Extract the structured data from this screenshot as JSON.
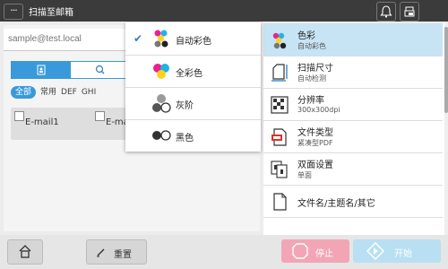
{
  "titlebar": {
    "menu_label": "···",
    "title": "扫描至邮箱",
    "icons": [
      "bell-icon",
      "trash-device-icon"
    ]
  },
  "left": {
    "email_placeholder": "sample@test.local",
    "filters": [
      "全部",
      "常用",
      "DEF",
      "GHI"
    ],
    "selected_filter": "全部",
    "entries": [
      "E-mail1",
      "E-ma"
    ]
  },
  "dropdown": {
    "selected": "自动彩色",
    "items": [
      {
        "label": "自动彩色",
        "icon": "auto-color-icon"
      },
      {
        "label": "全彩色",
        "icon": "full-color-icon"
      },
      {
        "label": "灰阶",
        "icon": "grayscale-icon"
      },
      {
        "label": "黑色",
        "icon": "black-icon"
      }
    ]
  },
  "settings": [
    {
      "label": "色彩",
      "value": "自动彩色",
      "icon": "color-icon",
      "active": true
    },
    {
      "label": "扫描尺寸",
      "value": "自动检测",
      "icon": "scan-size-icon"
    },
    {
      "label": "分辨率",
      "value": "300x300dpi",
      "icon": "resolution-icon"
    },
    {
      "label": "文件类型",
      "value": "紧凑型PDF",
      "icon": "pdf-icon"
    },
    {
      "label": "双面设置",
      "value": "单面",
      "icon": "duplex-icon"
    },
    {
      "label": "文件名/主题名/其它",
      "value": "",
      "icon": "file-icon"
    }
  ],
  "bottom": {
    "home_icon": "home-icon",
    "reset_label": "重置",
    "stop_label": "停止",
    "start_label": "开始"
  },
  "colors": {
    "accent": "#3a9ad9",
    "selected_row": "#c7e4f5",
    "stop": "#f2a6b5",
    "start": "#b9dff3",
    "titlebar": "#3b3b3b"
  }
}
